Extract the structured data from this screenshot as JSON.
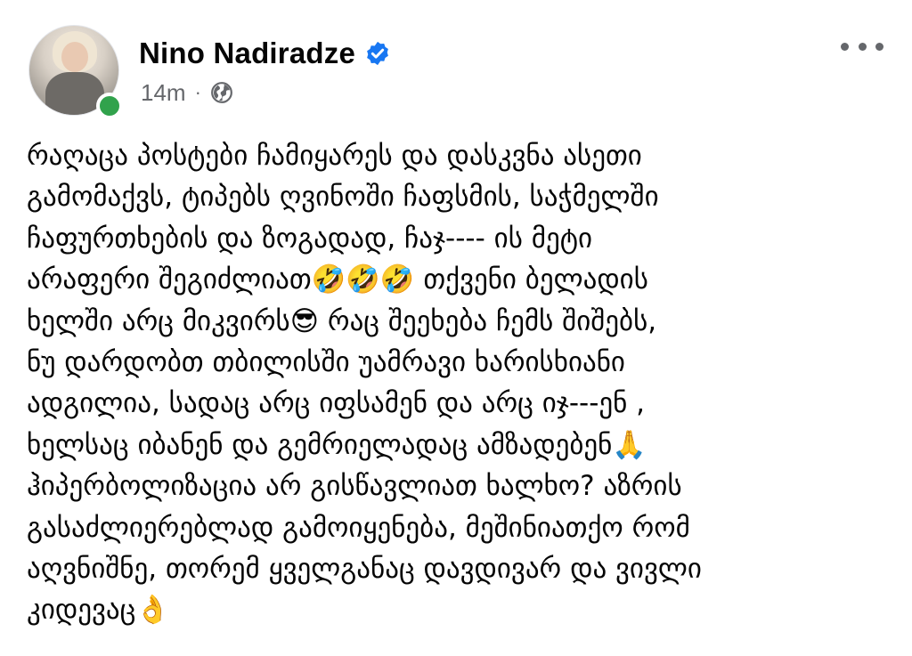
{
  "post": {
    "author": {
      "name": "Nino Nadiradze",
      "verified": true,
      "online": true
    },
    "time": "14m",
    "separator": "·",
    "audience_icon": "globe-icon",
    "lines": [
      "რაღაცა პოსტები ჩამიყარეს და დასკვნა ასეთი",
      "გამომაქვს, ტიპებს ღვინოში ჩაფსმის, საჭმელში",
      "ჩაფურთხების და ზოგადად, ჩაჯ---- ის მეტი",
      "არაფერი შეგიძლიათ🤣🤣🤣  თქვენი ბელადის",
      "ხელში არც მიკვირს😎 რაც შეეხება ჩემს შიშებს,",
      "ნუ დარდობთ თბილისში უამრავი ხარისხიანი",
      "ადგილია, სადაც არც იფსამენ და არც იჯ---ენ ,",
      "ხელსაც იბანენ და გემრიელადაც ამზადებენ🙏",
      "ჰიპერბოლიზაცია არ გისწავლიათ ხალხო? აზრის",
      "გასაძლიერებლად გამოიყენება, მეშინიათქო რომ",
      "აღვნიშნე, თორემ ყველგანაც დავდივარ და ვივლი",
      "კიდევაც👌"
    ]
  },
  "colors": {
    "text": "#050505",
    "secondary": "#65676b",
    "verified": "#1877f2",
    "online": "#31a24c"
  }
}
